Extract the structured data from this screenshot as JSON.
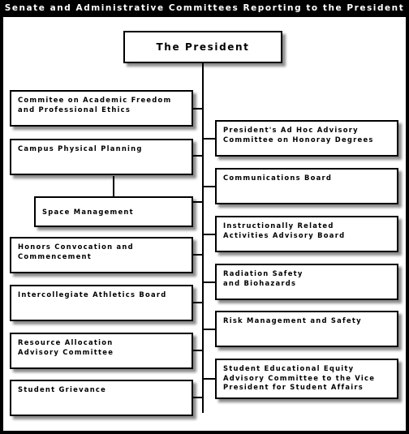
{
  "title": "Senate and Administrative Committees Reporting to the President",
  "colors": {
    "frame": "#000000",
    "canvas": "#ffffff",
    "box_border": "#000000",
    "text": "#000000",
    "title_text": "#ffffff"
  },
  "root": {
    "label": "The President"
  },
  "left_column": [
    {
      "label": "Commitee on Academic Freedom\nand Professional Ethics"
    },
    {
      "label": "Campus Physical Planning"
    },
    {
      "label": "Space Management",
      "indented": true
    },
    {
      "label": "Honors Convocation and\nCommencement"
    },
    {
      "label": "Intercollegiate Athletics Board"
    },
    {
      "label": "Resource Allocation\nAdvisory Committee"
    },
    {
      "label": "Student Grievance"
    }
  ],
  "right_column": [
    {
      "label": "President's Ad Hoc Advisory\nCommittee on Honoray Degrees"
    },
    {
      "label": "Communications Board"
    },
    {
      "label": "Instructionally Related\nActivities Advisory Board"
    },
    {
      "label": "Radiation Safety\nand Biohazards"
    },
    {
      "label": "Risk Management and Safety"
    },
    {
      "label": "Student Educational Equity\nAdvisory Committee to the Vice\nPresident for Student Affairs"
    }
  ]
}
